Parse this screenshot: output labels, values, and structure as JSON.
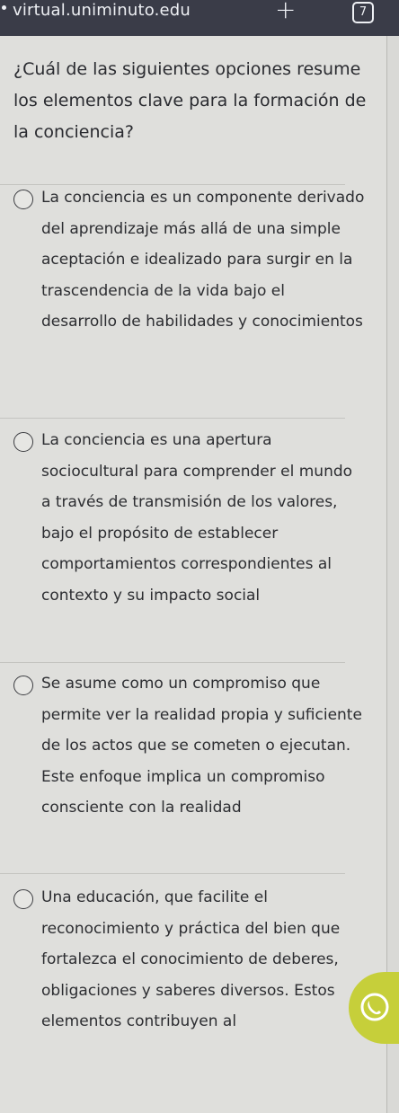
{
  "browser": {
    "url": "virtual.uniminuto.edu",
    "new_tab_icon": "plus-icon",
    "tab_count": "7"
  },
  "question": {
    "text": "¿Cuál de las siguientes opciones resume los elementos clave para la formación de la conciencia?"
  },
  "options": [
    {
      "text": "La conciencia es un componente derivado del aprendizaje más allá de una simple aceptación e idealizado para surgir en la trascendencia de la vida bajo el desarrollo de habilidades y conocimientos",
      "selected": false
    },
    {
      "text": "La conciencia es una apertura sociocultural para comprender el mundo a través de transmisión de los valores, bajo el propósito de establecer comportamientos correspondientes al contexto y su impacto social",
      "selected": false
    },
    {
      "text": "Se asume como un compromiso que permite ver la realidad propia y suficiente de los actos que se cometen o ejecutan. Este enfoque implica un compromiso consciente con la realidad",
      "selected": false
    },
    {
      "text": "Una educación, que facilite el reconocimiento y práctica del bien que fortalezca el conocimiento de deberes, obligaciones y saberes diversos. Estos elementos contribuyen al",
      "selected": false
    }
  ],
  "floating_button": {
    "icon": "whatsapp-icon",
    "color": "#c6cf3a"
  }
}
